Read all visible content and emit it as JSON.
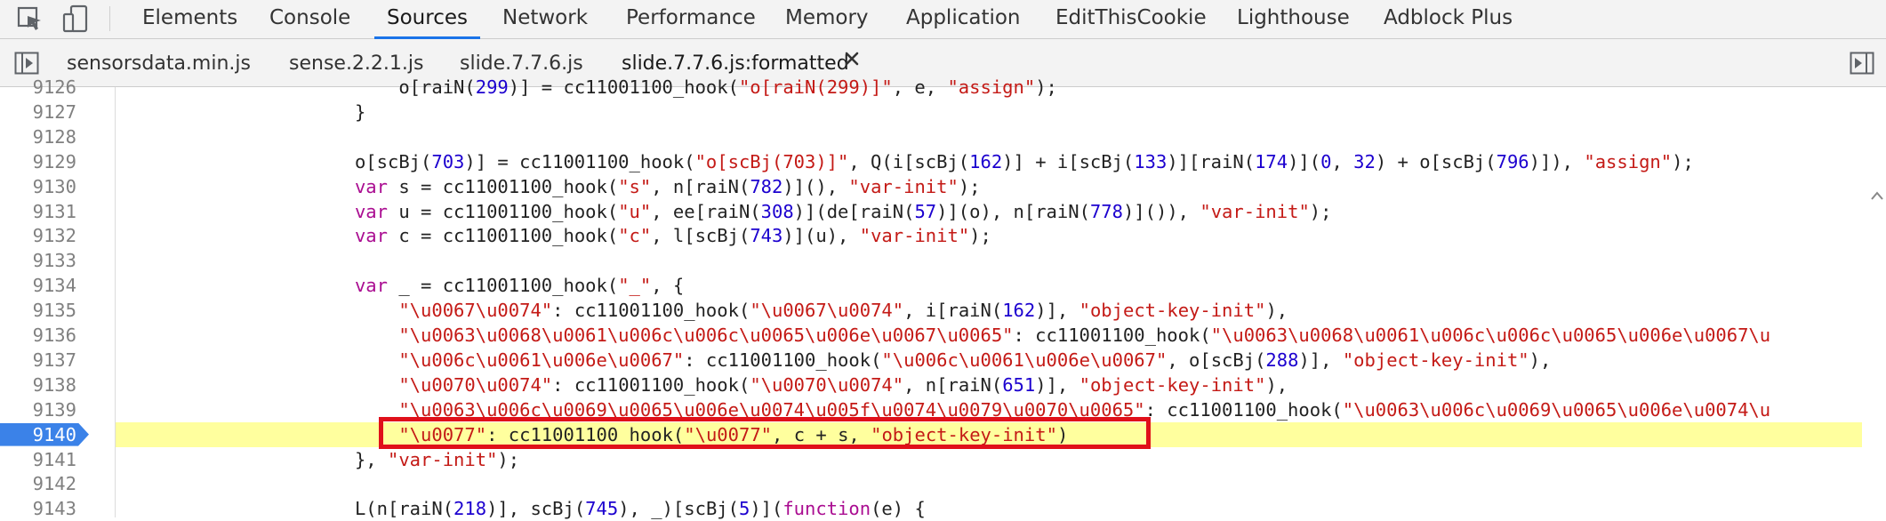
{
  "tabs": [
    "Elements",
    "Console",
    "Sources",
    "Network",
    "Performance",
    "Memory",
    "Application",
    "EditThisCookie",
    "Lighthouse",
    "Adblock Plus"
  ],
  "active_tab": "Sources",
  "file_tabs": [
    "sensorsdata.min.js",
    "sense.2.2.1.js",
    "slide.7.7.6.js",
    "slide.7.7.6.js:formatted"
  ],
  "active_file": "slide.7.7.6.js:formatted",
  "icons": {
    "inspect": "element-picker-icon",
    "device": "device-toolbar-icon",
    "nav_left": "show-navigator-icon",
    "close": "close-icon",
    "nav_right": "show-debugger-icon"
  },
  "colors": {
    "breakpoint": "#3b82e8",
    "highlight": "#ffff9e",
    "annotation": "#e0101a",
    "active_tab_underline": "#1a73e8"
  },
  "code": {
    "lines": [
      {
        "n": "9126",
        "t": "        o[raiN(299)] = cc11001100_hook(\"o[raiN(299)]\", e, \"assign\");"
      },
      {
        "n": "9127",
        "t": "    }"
      },
      {
        "n": "9128",
        "t": ""
      },
      {
        "n": "9129",
        "t": "    o[scBj(703)] = cc11001100_hook(\"o[scBj(703)]\", Q(i[scBj(162)] + i[scBj(133)][raiN(174)](0, 32) + o[scBj(796)]), \"assign\");"
      },
      {
        "n": "9130",
        "t": "    var s = cc11001100_hook(\"s\", n[raiN(782)](), \"var-init\");"
      },
      {
        "n": "9131",
        "t": "    var u = cc11001100_hook(\"u\", ee[raiN(308)](de[raiN(57)](o), n[raiN(778)]()), \"var-init\");"
      },
      {
        "n": "9132",
        "t": "    var c = cc11001100_hook(\"c\", l[scBj(743)](u), \"var-init\");"
      },
      {
        "n": "9133",
        "t": ""
      },
      {
        "n": "9134",
        "t": "    var _ = cc11001100_hook(\"_\", {"
      },
      {
        "n": "9135",
        "t": "        \"\\u0067\\u0074\": cc11001100_hook(\"\\u0067\\u0074\", i[raiN(162)], \"object-key-init\"),"
      },
      {
        "n": "9136",
        "t": "        \"\\u0063\\u0068\\u0061\\u006c\\u006c\\u0065\\u006e\\u0067\\u0065\": cc11001100_hook(\"\\u0063\\u0068\\u0061\\u006c\\u006c\\u0065\\u006e\\u0067\\u"
      },
      {
        "n": "9137",
        "t": "        \"\\u006c\\u0061\\u006e\\u0067\": cc11001100_hook(\"\\u006c\\u0061\\u006e\\u0067\", o[scBj(288)], \"object-key-init\"),"
      },
      {
        "n": "9138",
        "t": "        \"\\u0070\\u0074\": cc11001100_hook(\"\\u0070\\u0074\", n[raiN(651)], \"object-key-init\"),"
      },
      {
        "n": "9139",
        "t": "        \"\\u0063\\u006c\\u0069\\u0065\\u006e\\u0074\\u005f\\u0074\\u0079\\u0070\\u0065\": cc11001100_hook(\"\\u0063\\u006c\\u0069\\u0065\\u006e\\u0074\\u"
      },
      {
        "n": "9140",
        "t": "        \"\\u0077\": cc11001100_hook(\"\\u0077\", c + s, \"object-key-init\")"
      },
      {
        "n": "9141",
        "t": "    }, \"var-init\");"
      },
      {
        "n": "9142",
        "t": ""
      },
      {
        "n": "9143",
        "t": "    L(n[raiN(218)], scBj(745), _)[scBj(5)](function(e) {"
      }
    ],
    "breakpoint_line": "9140"
  }
}
